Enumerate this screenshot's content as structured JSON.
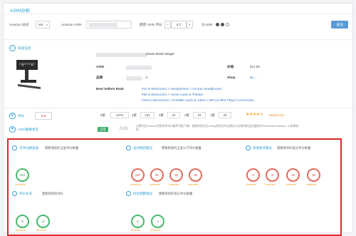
{
  "header": {
    "title": "ASIN分析"
  },
  "filters": {
    "site_label": "Amazon 站点",
    "site_value": "US",
    "asin_label": "Amazon ASIN",
    "rating_label": "期望 ASIN 评分",
    "rating_value": "4.7",
    "compare_label": "父ASIN",
    "query_button": "查询"
  },
  "product": {
    "section_label": "商品信息",
    "title_suffix": "phone Desk Hanger",
    "fields": [
      {
        "label": "ASIN",
        "value": ""
      },
      {
        "label": "价格",
        "value": "$14.99"
      },
      {
        "label": "品牌",
        "value": "...2"
      },
      {
        "label": "Shop",
        "value": "Bu..."
      }
    ],
    "best_sellers_label": "Best Sellers Rank",
    "ranks": [
      "#10 in Electronics > Headphones > On-Ear Headphones",
      "#58 in Electronics > Home Audio & Theater",
      "#249 in Electronics > Portable Audio & Video > MP3 & MP4 Player Accessories"
    ]
  },
  "ratings": {
    "section_label": "评分",
    "section_badge": "4.6",
    "cells": [
      {
        "label": "5星",
        "value": "1375"
      },
      {
        "label": "4星",
        "value": "152"
      },
      {
        "label": "3星",
        "value": "34"
      },
      {
        "label": "2星",
        "value": "29"
      },
      {
        "label": "1星",
        "value": "28"
      }
    ],
    "summary": "1848(4.63)",
    "star_count": 4.5
  },
  "health": {
    "section_label": "ASIN健康状态",
    "status": "正常",
    "score": "0.03",
    "note": "日累积在Amazon列表排序评价概率可能下降。需要持续关注Listing表现及评论情况以及保持商品质量提升Review与Feedback...以改善流程"
  },
  "cards": [
    {
      "title": "可评分精准值",
      "desc": "需要增加的五星评价数量",
      "rings": [
        {
          "value": "464",
          "color": "green"
        }
      ]
    },
    {
      "title": "差评挽回建议",
      "desc": "需要移除的五星以下评价数量",
      "rings": [
        {
          "value": "197",
          "color": "red"
        },
        {
          "value": "81",
          "color": "red"
        },
        {
          "value": "29",
          "color": "red"
        },
        {
          "value": "26",
          "color": "red"
        }
      ]
    },
    {
      "title": "修改留评建议",
      "desc": "需要修改的低分评价数量",
      "rings": [
        {
          "value": "9",
          "color": "red"
        },
        {
          "value": "9",
          "color": "red"
        },
        {
          "value": "16",
          "color": "red"
        },
        {
          "value": "26",
          "color": "red"
        }
      ]
    },
    {
      "title": "评价补充",
      "desc": "需要移除的评价",
      "rings": [
        {
          "value": "9",
          "color": "green"
        },
        {
          "value": "12",
          "color": "green"
        }
      ]
    },
    {
      "title": "综合调整建议",
      "desc": "需要移除的低分评价数量",
      "rings": [
        {
          "value": "9",
          "color": "green"
        },
        {
          "value": "3",
          "color": "green"
        }
      ]
    }
  ]
}
